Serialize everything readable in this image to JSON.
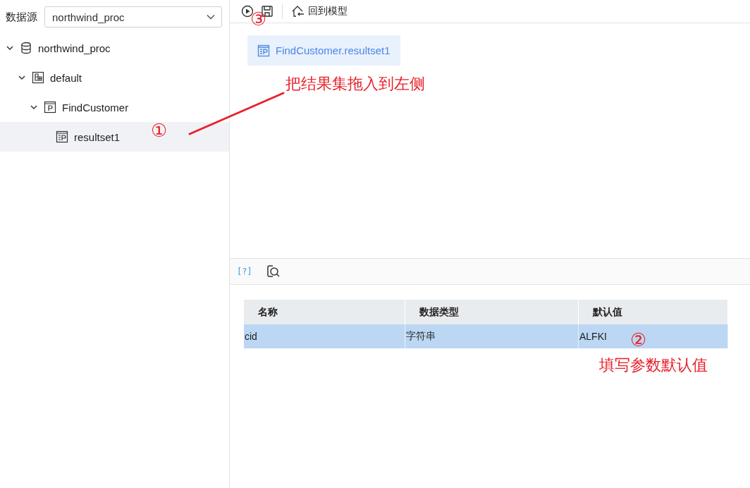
{
  "datasource": {
    "label": "数据源",
    "value": "northwind_proc"
  },
  "tree": [
    {
      "label": "northwind_proc",
      "kind": "database",
      "expanded": true,
      "selected": false,
      "children": [
        {
          "label": "default",
          "kind": "schema",
          "expanded": true,
          "selected": false,
          "children": [
            {
              "label": "FindCustomer",
              "kind": "procedure",
              "expanded": true,
              "selected": false,
              "children": [
                {
                  "label": "resultset1",
                  "kind": "resultset",
                  "selected": true
                }
              ]
            }
          ]
        }
      ]
    }
  ],
  "toolbar": {
    "back_label": "回到模型"
  },
  "canvas": {
    "items": [
      {
        "label": "FindCustomer.resultset1"
      }
    ]
  },
  "params_toolbar": {
    "variable_icon": "[?]"
  },
  "params_table": {
    "columns": [
      "名称",
      "数据类型",
      "默认值"
    ],
    "rows": [
      {
        "cells": [
          "cid",
          "字符串",
          "ALFKI"
        ],
        "selected": true
      }
    ]
  },
  "annotations": [
    {
      "kind": "marker",
      "text": "①"
    },
    {
      "kind": "marker",
      "text": "②"
    },
    {
      "kind": "marker",
      "text": "③"
    },
    {
      "kind": "note",
      "text": "把结果集拖入到左侧"
    },
    {
      "kind": "note",
      "text": "填写参数默认值"
    }
  ]
}
